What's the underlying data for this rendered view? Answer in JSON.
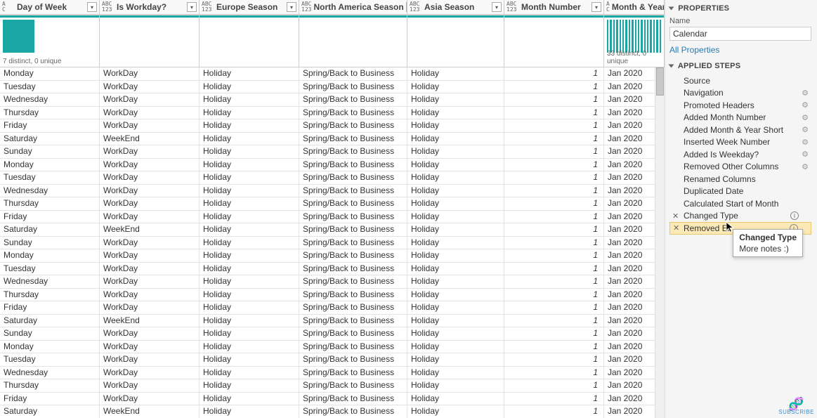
{
  "columns": [
    {
      "label": "Day of Week",
      "type_top": "A",
      "type_bot": "C",
      "stats": "7 distinct, 0 unique",
      "chart": "one"
    },
    {
      "label": "Is Workday?",
      "type_top": "ABC",
      "type_bot": "123",
      "stats": "",
      "chart": "none"
    },
    {
      "label": "Europe Season",
      "type_top": "ABC",
      "type_bot": "123",
      "stats": "",
      "chart": "none"
    },
    {
      "label": "North America Season",
      "type_top": "ABC",
      "type_bot": "123",
      "stats": "",
      "chart": "none"
    },
    {
      "label": "Asia Season",
      "type_top": "ABC",
      "type_bot": "123",
      "stats": "",
      "chart": "none"
    },
    {
      "label": "Month Number",
      "type_top": "ABC",
      "type_bot": "123",
      "stats": "",
      "chart": "none"
    },
    {
      "label": "Month & Year",
      "type_top": "A",
      "type_bot": "C",
      "stats": "33 distinct, 0 unique",
      "chart": "multi"
    }
  ],
  "rows": [
    [
      "Monday",
      "WorkDay",
      "Holiday",
      "Spring/Back to Business",
      "Holiday",
      "1",
      "Jan 2020"
    ],
    [
      "Tuesday",
      "WorkDay",
      "Holiday",
      "Spring/Back to Business",
      "Holiday",
      "1",
      "Jan 2020"
    ],
    [
      "Wednesday",
      "WorkDay",
      "Holiday",
      "Spring/Back to Business",
      "Holiday",
      "1",
      "Jan 2020"
    ],
    [
      "Thursday",
      "WorkDay",
      "Holiday",
      "Spring/Back to Business",
      "Holiday",
      "1",
      "Jan 2020"
    ],
    [
      "Friday",
      "WorkDay",
      "Holiday",
      "Spring/Back to Business",
      "Holiday",
      "1",
      "Jan 2020"
    ],
    [
      "Saturday",
      "WeekEnd",
      "Holiday",
      "Spring/Back to Business",
      "Holiday",
      "1",
      "Jan 2020"
    ],
    [
      "Sunday",
      "WorkDay",
      "Holiday",
      "Spring/Back to Business",
      "Holiday",
      "1",
      "Jan 2020"
    ],
    [
      "Monday",
      "WorkDay",
      "Holiday",
      "Spring/Back to Business",
      "Holiday",
      "1",
      "Jan 2020"
    ],
    [
      "Tuesday",
      "WorkDay",
      "Holiday",
      "Spring/Back to Business",
      "Holiday",
      "1",
      "Jan 2020"
    ],
    [
      "Wednesday",
      "WorkDay",
      "Holiday",
      "Spring/Back to Business",
      "Holiday",
      "1",
      "Jan 2020"
    ],
    [
      "Thursday",
      "WorkDay",
      "Holiday",
      "Spring/Back to Business",
      "Holiday",
      "1",
      "Jan 2020"
    ],
    [
      "Friday",
      "WorkDay",
      "Holiday",
      "Spring/Back to Business",
      "Holiday",
      "1",
      "Jan 2020"
    ],
    [
      "Saturday",
      "WeekEnd",
      "Holiday",
      "Spring/Back to Business",
      "Holiday",
      "1",
      "Jan 2020"
    ],
    [
      "Sunday",
      "WorkDay",
      "Holiday",
      "Spring/Back to Business",
      "Holiday",
      "1",
      "Jan 2020"
    ],
    [
      "Monday",
      "WorkDay",
      "Holiday",
      "Spring/Back to Business",
      "Holiday",
      "1",
      "Jan 2020"
    ],
    [
      "Tuesday",
      "WorkDay",
      "Holiday",
      "Spring/Back to Business",
      "Holiday",
      "1",
      "Jan 2020"
    ],
    [
      "Wednesday",
      "WorkDay",
      "Holiday",
      "Spring/Back to Business",
      "Holiday",
      "1",
      "Jan 2020"
    ],
    [
      "Thursday",
      "WorkDay",
      "Holiday",
      "Spring/Back to Business",
      "Holiday",
      "1",
      "Jan 2020"
    ],
    [
      "Friday",
      "WorkDay",
      "Holiday",
      "Spring/Back to Business",
      "Holiday",
      "1",
      "Jan 2020"
    ],
    [
      "Saturday",
      "WeekEnd",
      "Holiday",
      "Spring/Back to Business",
      "Holiday",
      "1",
      "Jan 2020"
    ],
    [
      "Sunday",
      "WorkDay",
      "Holiday",
      "Spring/Back to Business",
      "Holiday",
      "1",
      "Jan 2020"
    ],
    [
      "Monday",
      "WorkDay",
      "Holiday",
      "Spring/Back to Business",
      "Holiday",
      "1",
      "Jan 2020"
    ],
    [
      "Tuesday",
      "WorkDay",
      "Holiday",
      "Spring/Back to Business",
      "Holiday",
      "1",
      "Jan 2020"
    ],
    [
      "Wednesday",
      "WorkDay",
      "Holiday",
      "Spring/Back to Business",
      "Holiday",
      "1",
      "Jan 2020"
    ],
    [
      "Thursday",
      "WorkDay",
      "Holiday",
      "Spring/Back to Business",
      "Holiday",
      "1",
      "Jan 2020"
    ],
    [
      "Friday",
      "WorkDay",
      "Holiday",
      "Spring/Back to Business",
      "Holiday",
      "1",
      "Jan 2020"
    ],
    [
      "Saturday",
      "WeekEnd",
      "Holiday",
      "Spring/Back to Business",
      "Holiday",
      "1",
      "Jan 2020"
    ]
  ],
  "properties": {
    "panel_title": "PROPERTIES",
    "name_label": "Name",
    "name_value": "Calendar",
    "all_props": "All Properties"
  },
  "applied_steps": {
    "panel_title": "APPLIED STEPS",
    "steps": [
      {
        "label": "Source",
        "gear": false,
        "x": false,
        "info": false
      },
      {
        "label": "Navigation",
        "gear": true,
        "x": false,
        "info": false
      },
      {
        "label": "Promoted Headers",
        "gear": true,
        "x": false,
        "info": false
      },
      {
        "label": "Added Month Number",
        "gear": true,
        "x": false,
        "info": false
      },
      {
        "label": "Added Month & Year Short",
        "gear": true,
        "x": false,
        "info": false
      },
      {
        "label": "Inserted Week Number",
        "gear": true,
        "x": false,
        "info": false
      },
      {
        "label": "Added Is Weekday?",
        "gear": true,
        "x": false,
        "info": false
      },
      {
        "label": "Removed Other Columns",
        "gear": true,
        "x": false,
        "info": false
      },
      {
        "label": "Renamed Columns",
        "gear": false,
        "x": false,
        "info": false
      },
      {
        "label": "Duplicated Date",
        "gear": false,
        "x": false,
        "info": false
      },
      {
        "label": "Calculated Start of Month",
        "gear": false,
        "x": false,
        "info": false
      },
      {
        "label": "Changed Type",
        "gear": false,
        "x": true,
        "info": true,
        "selected": false
      },
      {
        "label": "Removed Er",
        "gear": false,
        "x": true,
        "info": true,
        "selected": true
      }
    ]
  },
  "tooltip": {
    "title": "Changed Type",
    "body": "More notes :)"
  },
  "subscribe_label": "SUBSCRIBE"
}
